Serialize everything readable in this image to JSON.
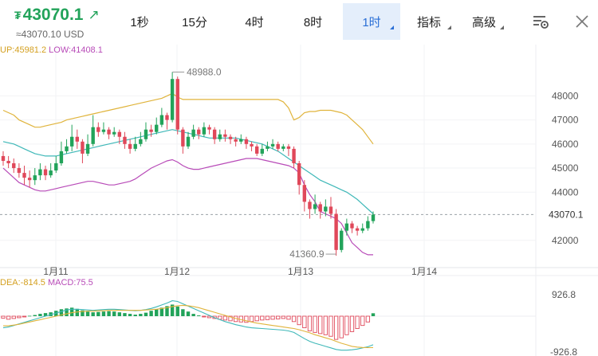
{
  "header": {
    "currency_symbol": "₮",
    "price": "43070.1",
    "trend_icon": "arrow-up-right-icon",
    "fiat_price": "≈43070.10 USD"
  },
  "tabs": [
    {
      "label": "1秒",
      "active": false,
      "dropdown": false
    },
    {
      "label": "15分",
      "active": false,
      "dropdown": false
    },
    {
      "label": "4时",
      "active": false,
      "dropdown": false
    },
    {
      "label": "8时",
      "active": false,
      "dropdown": false
    },
    {
      "label": "1时",
      "active": true,
      "dropdown": true
    },
    {
      "label": "指标",
      "active": false,
      "dropdown": true
    },
    {
      "label": "高级",
      "active": false,
      "dropdown": true
    }
  ],
  "icons": {
    "settings": "chart-settings-icon",
    "close": "close-icon"
  },
  "indicators": {
    "boll_up": "UP:45981.2",
    "boll_low": "LOW:41408.1",
    "dea": "DEA:-814.5",
    "macd": "MACD:75.5"
  },
  "colors": {
    "up": "#22a35a",
    "down": "#e0485a",
    "upper_band": "#e0b43c",
    "mid_band": "#3fb8b8",
    "lower_band": "#b84bb8",
    "accent": "#2a6fd6"
  },
  "chart_data": [
    {
      "type": "candlestick",
      "y_ticks": [
        "48000",
        "47000",
        "46000",
        "45000",
        "44000",
        "42000"
      ],
      "ylim": [
        41000,
        49500
      ],
      "x_labels": [
        "1月11",
        "1月12",
        "1月13",
        "1月14"
      ],
      "high_label": "48988.0",
      "low_label": "41360.9",
      "last_price_label": "43070.1",
      "last_price": 43070.1,
      "candles": [
        [
          45500,
          45300,
          45700,
          45100
        ],
        [
          45300,
          45200,
          45500,
          45000
        ],
        [
          45200,
          45000,
          45400,
          44800
        ],
        [
          45000,
          44800,
          45200,
          44600
        ],
        [
          44800,
          44600,
          45100,
          44300
        ],
        [
          44600,
          44500,
          44900,
          44200
        ],
        [
          44500,
          44700,
          45000,
          44300
        ],
        [
          44700,
          44950,
          45200,
          44500
        ],
        [
          44950,
          44700,
          45100,
          44500
        ],
        [
          44700,
          44900,
          45200,
          44600
        ],
        [
          44900,
          45200,
          45500,
          44800
        ],
        [
          45200,
          45700,
          46100,
          45100
        ],
        [
          45700,
          45900,
          46200,
          45600
        ],
        [
          45900,
          46300,
          46800,
          45700
        ],
        [
          46300,
          46100,
          46600,
          45800
        ],
        [
          46100,
          45600,
          46200,
          45200
        ],
        [
          45600,
          46000,
          46400,
          45500
        ],
        [
          46000,
          46700,
          47200,
          45900
        ],
        [
          46700,
          46500,
          46900,
          46300
        ],
        [
          46500,
          46600,
          46900,
          46400
        ],
        [
          46600,
          46400,
          46700,
          46200
        ],
        [
          46400,
          46500,
          46700,
          46300
        ],
        [
          46500,
          46300,
          46600,
          46000
        ],
        [
          46300,
          46000,
          46500,
          45800
        ],
        [
          46000,
          45800,
          46200,
          45600
        ],
        [
          45800,
          46000,
          46300,
          45700
        ],
        [
          46000,
          46200,
          46500,
          45900
        ],
        [
          46200,
          46600,
          46900,
          46100
        ],
        [
          46600,
          46500,
          46800,
          46300
        ],
        [
          46500,
          46800,
          47100,
          46400
        ],
        [
          46800,
          47200,
          47500,
          46700
        ],
        [
          47200,
          47000,
          47300,
          46600
        ],
        [
          47000,
          48700,
          48988,
          46900
        ],
        [
          48700,
          46600,
          48800,
          46400
        ],
        [
          46600,
          45900,
          46700,
          45600
        ],
        [
          45900,
          46300,
          46500,
          45800
        ],
        [
          46300,
          46600,
          46800,
          46200
        ],
        [
          46600,
          46400,
          46700,
          46200
        ],
        [
          46400,
          46700,
          46900,
          46300
        ],
        [
          46700,
          46600,
          46800,
          46400
        ],
        [
          46600,
          46200,
          46700,
          46000
        ],
        [
          46200,
          46400,
          46600,
          46100
        ],
        [
          46400,
          46300,
          46600,
          46100
        ],
        [
          46300,
          46200,
          46400,
          46000
        ],
        [
          46200,
          46100,
          46300,
          45900
        ],
        [
          46100,
          46200,
          46400,
          46000
        ],
        [
          46200,
          46000,
          46300,
          45800
        ],
        [
          46000,
          45900,
          46100,
          45700
        ],
        [
          45900,
          45600,
          46000,
          45500
        ],
        [
          45600,
          45800,
          46000,
          45500
        ],
        [
          45800,
          45900,
          46100,
          45700
        ],
        [
          45900,
          46000,
          46200,
          45800
        ],
        [
          46000,
          45800,
          46100,
          45700
        ],
        [
          45800,
          45900,
          46000,
          45700
        ],
        [
          45900,
          45800,
          46000,
          45500
        ],
        [
          45800,
          45200,
          45900,
          45000
        ],
        [
          45200,
          44300,
          45300,
          43900
        ],
        [
          44300,
          43600,
          44500,
          43200
        ],
        [
          43600,
          43300,
          43700,
          42900
        ],
        [
          43300,
          43500,
          43900,
          43100
        ],
        [
          43500,
          43200,
          43600,
          42900
        ],
        [
          43200,
          43400,
          43700,
          43000
        ],
        [
          43400,
          43100,
          43800,
          42900
        ],
        [
          43100,
          41600,
          43300,
          41361
        ],
        [
          41600,
          42400,
          42500,
          41500
        ],
        [
          42400,
          42700,
          42900,
          42200
        ],
        [
          42700,
          42500,
          42800,
          42300
        ],
        [
          42500,
          42400,
          42600,
          42200
        ],
        [
          42400,
          42500,
          42700,
          42300
        ],
        [
          42500,
          42800,
          43000,
          42400
        ],
        [
          42800,
          43070.1,
          43200,
          42700
        ]
      ],
      "upper_band": [
        47400,
        47300,
        47200,
        47000,
        46900,
        46800,
        46700,
        46700,
        46750,
        46800,
        46850,
        46900,
        47000,
        47050,
        47100,
        47150,
        47200,
        47250,
        47300,
        47350,
        47400,
        47450,
        47500,
        47550,
        47600,
        47650,
        47700,
        47750,
        47800,
        47850,
        47900,
        48000,
        48100,
        47950,
        47850,
        47850,
        47850,
        47850,
        47850,
        47850,
        47850,
        47850,
        47850,
        47850,
        47850,
        47850,
        47850,
        47850,
        47850,
        47850,
        47850,
        47850,
        47850,
        47750,
        47500,
        47000,
        47100,
        47300,
        47350,
        47350,
        47400,
        47400,
        47400,
        47350,
        47300,
        47200,
        47000,
        46800,
        46600,
        46300,
        46000
      ],
      "mid_band": [
        46100,
        46050,
        46000,
        45900,
        45800,
        45700,
        45600,
        45550,
        45500,
        45500,
        45500,
        45550,
        45600,
        45650,
        45700,
        45750,
        45800,
        45850,
        45900,
        45950,
        46000,
        46050,
        46100,
        46150,
        46200,
        46250,
        46300,
        46350,
        46400,
        46450,
        46500,
        46550,
        46600,
        46550,
        46500,
        46450,
        46400,
        46350,
        46300,
        46250,
        46250,
        46250,
        46250,
        46250,
        46250,
        46200,
        46150,
        46100,
        46050,
        46000,
        45900,
        45800,
        45700,
        45550,
        45400,
        45250,
        45100,
        44950,
        44800,
        44650,
        44500,
        44400,
        44300,
        44200,
        44100,
        44000,
        43850,
        43700,
        43500,
        43300,
        43100
      ],
      "lower_band": [
        45000,
        44800,
        44600,
        44400,
        44300,
        44200,
        44100,
        44050,
        44050,
        44100,
        44150,
        44200,
        44250,
        44300,
        44350,
        44400,
        44450,
        44450,
        44400,
        44350,
        44300,
        44300,
        44350,
        44400,
        44450,
        44550,
        44700,
        44850,
        45000,
        45100,
        45200,
        45300,
        45350,
        45250,
        45100,
        45000,
        44950,
        44950,
        45000,
        45050,
        45100,
        45150,
        45200,
        45250,
        45300,
        45350,
        45400,
        45400,
        45400,
        45350,
        45300,
        45250,
        45200,
        45150,
        45100,
        45000,
        44800,
        44300,
        43900,
        43600,
        43200,
        43100,
        43000,
        42900,
        42700,
        42300,
        41900,
        41700,
        41500,
        41400,
        41400
      ]
    },
    {
      "type": "macd",
      "y_ticks": [
        "926.8",
        "-926.8"
      ],
      "ylim": [
        -926.8,
        926.8
      ],
      "histogram": [
        -50,
        -80,
        -60,
        -40,
        -20,
        10,
        30,
        60,
        80,
        100,
        140,
        180,
        200,
        220,
        190,
        150,
        120,
        100,
        110,
        120,
        130,
        120,
        100,
        80,
        60,
        40,
        60,
        90,
        140,
        180,
        220,
        260,
        300,
        250,
        180,
        120,
        60,
        20,
        -20,
        -40,
        -60,
        -80,
        -100,
        -120,
        -140,
        -150,
        -160,
        -140,
        -120,
        -100,
        -90,
        -80,
        -70,
        -60,
        -80,
        -140,
        -220,
        -300,
        -380,
        -420,
        -450,
        -480,
        -520,
        -600,
        -560,
        -480,
        -400,
        -320,
        -240,
        -150,
        75.5
      ],
      "dif": [
        -300,
        -280,
        -240,
        -200,
        -160,
        -120,
        -80,
        -40,
        0,
        40,
        80,
        120,
        160,
        180,
        180,
        170,
        160,
        150,
        160,
        170,
        180,
        180,
        170,
        160,
        150,
        140,
        150,
        170,
        200,
        240,
        290,
        340,
        400,
        380,
        320,
        260,
        200,
        140,
        80,
        20,
        -40,
        -90,
        -140,
        -180,
        -220,
        -250,
        -280,
        -300,
        -310,
        -320,
        -330,
        -340,
        -350,
        -360,
        -380,
        -420,
        -500,
        -580,
        -650,
        -700,
        -740,
        -780,
        -820,
        -860,
        -880,
        -880,
        -870,
        -850,
        -820,
        -790,
        -740
      ],
      "dea": [
        -250,
        -250,
        -230,
        -210,
        -180,
        -150,
        -120,
        -90,
        -60,
        -30,
        0,
        30,
        60,
        90,
        110,
        120,
        130,
        130,
        140,
        140,
        150,
        150,
        150,
        150,
        150,
        150,
        150,
        160,
        170,
        180,
        200,
        220,
        250,
        270,
        280,
        270,
        250,
        220,
        180,
        140,
        100,
        60,
        20,
        -20,
        -60,
        -90,
        -120,
        -150,
        -180,
        -200,
        -220,
        -240,
        -260,
        -280,
        -300,
        -320,
        -350,
        -390,
        -430,
        -480,
        -520,
        -560,
        -600,
        -650,
        -700,
        -740,
        -780,
        -800,
        -810,
        -814,
        -814.5
      ]
    }
  ]
}
